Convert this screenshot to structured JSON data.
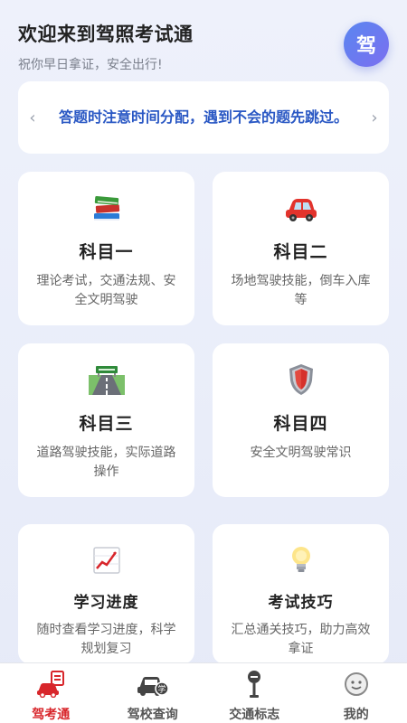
{
  "header": {
    "title": "欢迎来到驾照考试通",
    "subtitle": "祝你早日拿证，安全出行!",
    "avatar_text": "驾"
  },
  "tip": {
    "text": "答题时注意时间分配，遇到不会的题先跳过。",
    "prev": "‹",
    "next": "›"
  },
  "cards": [
    {
      "name": "科目一",
      "desc": "理论考试，交通法规、安全文明驾驶",
      "icon": "books-icon"
    },
    {
      "name": "科目二",
      "desc": "场地驾驶技能，倒车入库等",
      "icon": "car-icon"
    },
    {
      "name": "科目三",
      "desc": "道路驾驶技能，实际道路操作",
      "icon": "road-icon"
    },
    {
      "name": "科目四",
      "desc": "安全文明驾驶常识",
      "icon": "shield-icon"
    },
    {
      "name": "学习进度",
      "desc": "随时查看学习进度，科学规划复习",
      "icon": "chart-icon"
    },
    {
      "name": "考试技巧",
      "desc": "汇总通关技巧，助力高效拿证",
      "icon": "lightbulb-icon"
    }
  ],
  "tabs": [
    {
      "label": "驾考通",
      "icon": "car-clipboard-icon",
      "active": true
    },
    {
      "label": "驾校查询",
      "icon": "school-car-icon",
      "active": false
    },
    {
      "label": "交通标志",
      "icon": "traffic-sign-icon",
      "active": false
    },
    {
      "label": "我的",
      "icon": "profile-face-icon",
      "active": false
    }
  ],
  "colors": {
    "accent": "#2a58c4",
    "active_tab": "#d8262b",
    "avatar": "#6a7bf0"
  }
}
